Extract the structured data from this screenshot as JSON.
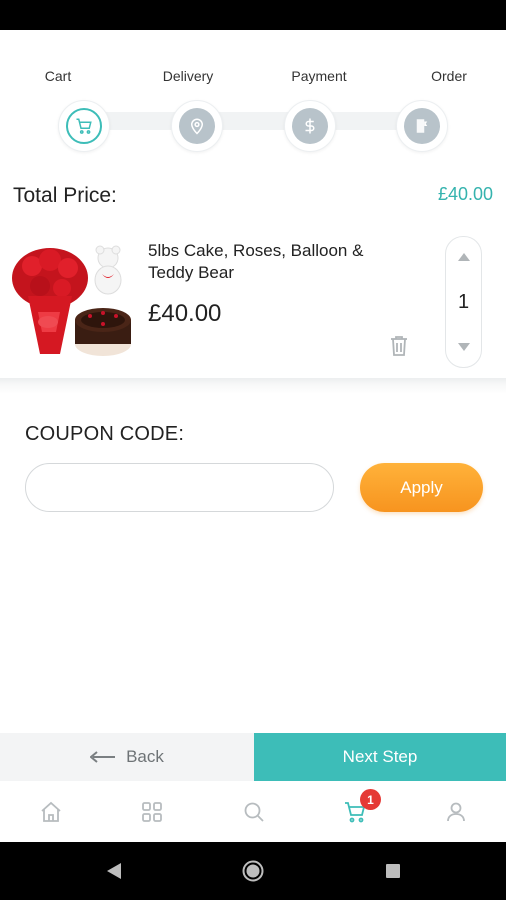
{
  "stepper": {
    "steps": [
      {
        "label": "Cart",
        "icon": "cart-icon",
        "state": "active"
      },
      {
        "label": "Delivery",
        "icon": "location-pin-icon",
        "state": "inactive"
      },
      {
        "label": "Payment",
        "icon": "dollar-icon",
        "state": "inactive"
      },
      {
        "label": "Order",
        "icon": "order-flag-icon",
        "state": "inactive"
      }
    ]
  },
  "summary": {
    "total_label": "Total Price:",
    "total_value": "£40.00"
  },
  "cart": {
    "items": [
      {
        "name": "5lbs Cake, Roses, Balloon & Teddy Bear",
        "price": "£40.00",
        "quantity": "1"
      }
    ]
  },
  "coupon": {
    "label": "COUPON CODE:",
    "value": "",
    "placeholder": "",
    "apply_label": "Apply"
  },
  "actions": {
    "back_label": "Back",
    "next_label": "Next Step"
  },
  "tabbar": {
    "cart_badge": "1",
    "tabs": [
      "home-icon",
      "grid-icon",
      "search-icon",
      "cart-icon",
      "profile-icon"
    ]
  },
  "colors": {
    "accent": "#3dbdb8",
    "apply": "#f7941f",
    "badge": "#e53935",
    "inactive_step": "#b8c3ca"
  }
}
